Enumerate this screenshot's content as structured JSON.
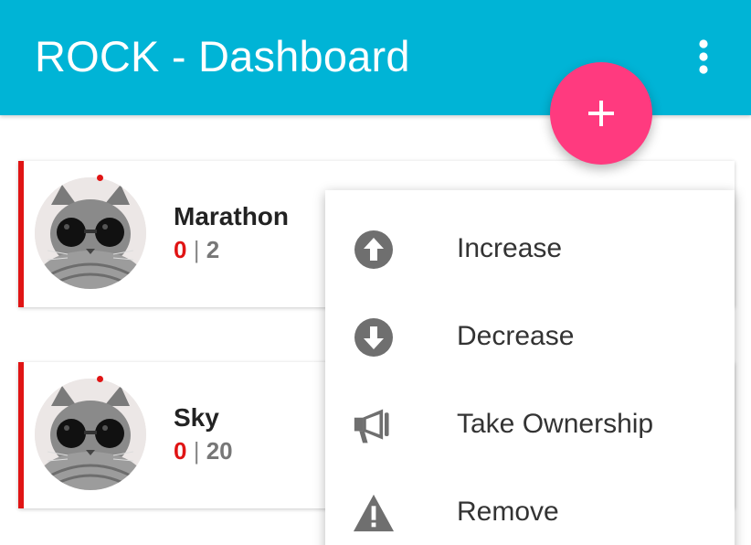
{
  "appbar": {
    "title": "ROCK - Dashboard",
    "color": "#00b4d6",
    "overflow_icon": "more-vert-icon"
  },
  "fab": {
    "icon": "plus-icon",
    "color": "#ff3a7f"
  },
  "cards": [
    {
      "name": "Marathon",
      "current": "0",
      "separator": "|",
      "total": "2",
      "accent": "#e01414",
      "avatar": "cat-with-sunglasses"
    },
    {
      "name": "Sky",
      "current": "0",
      "separator": "|",
      "total": "20",
      "accent": "#e01414",
      "avatar": "cat-with-sunglasses"
    }
  ],
  "menu": {
    "items": [
      {
        "label": "Increase",
        "icon": "arrow-up-circle-icon"
      },
      {
        "label": "Decrease",
        "icon": "arrow-down-circle-icon"
      },
      {
        "label": "Take Ownership",
        "icon": "megaphone-icon"
      },
      {
        "label": "Remove",
        "icon": "warning-icon"
      }
    ]
  }
}
